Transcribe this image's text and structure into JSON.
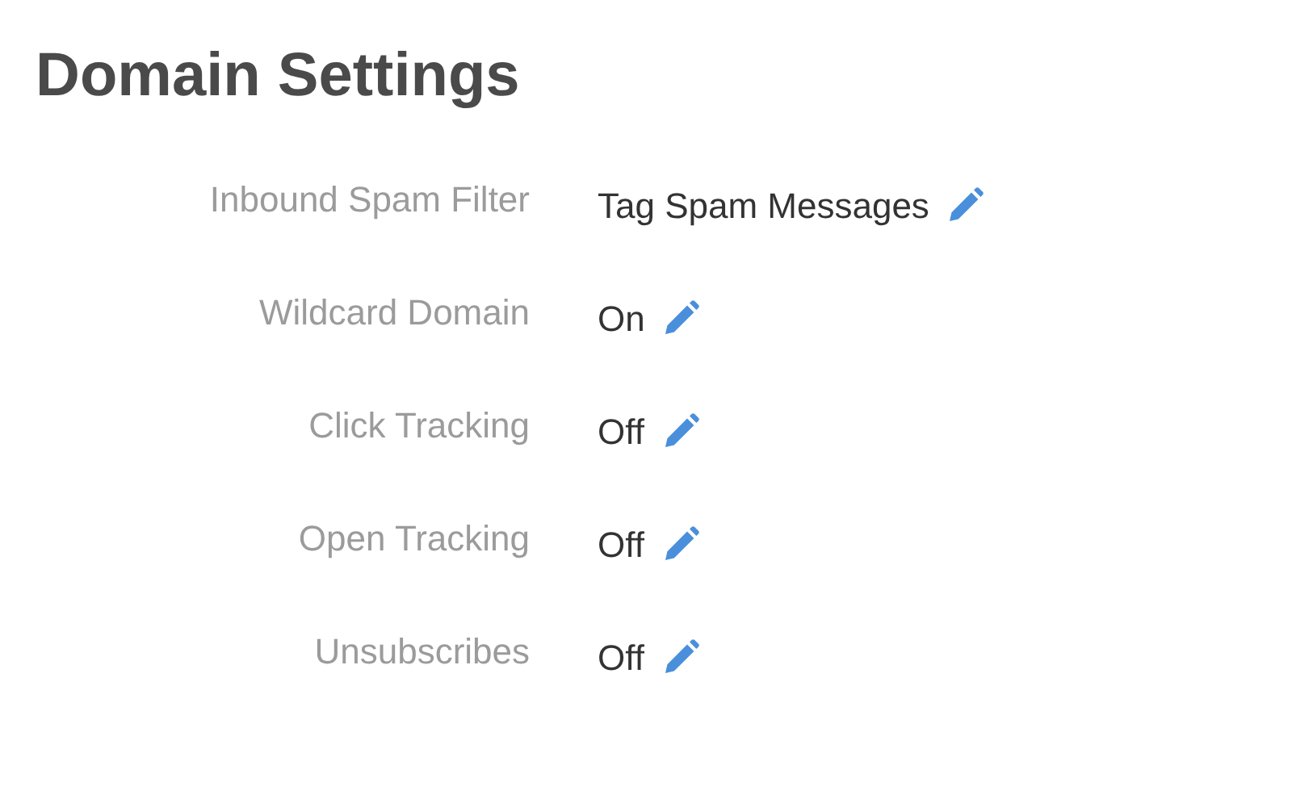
{
  "title": "Domain Settings",
  "settings": [
    {
      "label": "Inbound Spam Filter",
      "value": "Tag Spam Messages"
    },
    {
      "label": "Wildcard Domain",
      "value": "On"
    },
    {
      "label": "Click Tracking",
      "value": "Off"
    },
    {
      "label": "Open Tracking",
      "value": "Off"
    },
    {
      "label": "Unsubscribes",
      "value": "Off"
    }
  ]
}
